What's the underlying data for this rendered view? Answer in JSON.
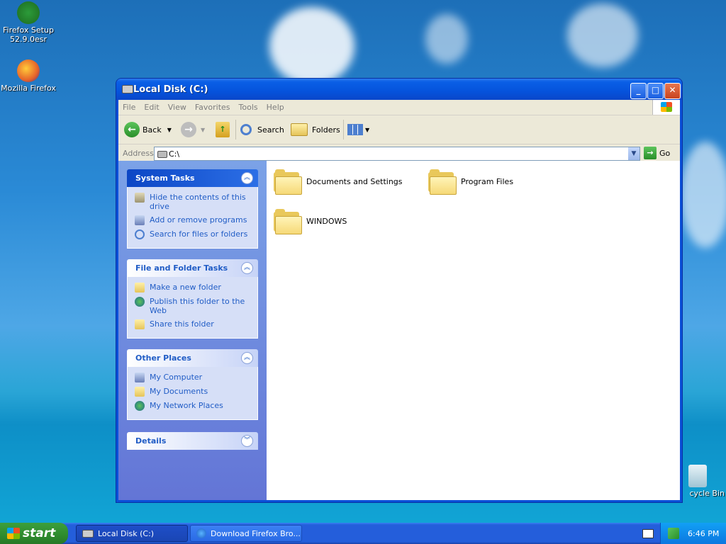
{
  "desktop": {
    "icons": [
      {
        "label": "Firefox Setup 52.9.0esr"
      },
      {
        "label": "Mozilla Firefox"
      },
      {
        "label": "cycle Bin"
      }
    ]
  },
  "window": {
    "title": "Local Disk (C:)",
    "controls": {
      "minimize": "_",
      "maximize": "□",
      "close": "✕"
    },
    "menu": [
      "File",
      "Edit",
      "View",
      "Favorites",
      "Tools",
      "Help"
    ],
    "toolbar": {
      "back": "Back",
      "search": "Search",
      "folders": "Folders"
    },
    "address": {
      "label": "Address",
      "value": "C:\\",
      "go": "Go"
    },
    "panels": [
      {
        "title": "System Tasks",
        "items": [
          "Hide the contents of this drive",
          "Add or remove programs",
          "Search for files or folders"
        ]
      },
      {
        "title": "File and Folder Tasks",
        "items": [
          "Make a new folder",
          "Publish this folder to the Web",
          "Share this folder"
        ]
      },
      {
        "title": "Other Places",
        "items": [
          "My Computer",
          "My Documents",
          "My Network Places"
        ]
      },
      {
        "title": "Details",
        "items": []
      }
    ],
    "folders": [
      "Documents and Settings",
      "Program Files",
      "WINDOWS"
    ]
  },
  "taskbar": {
    "start_label": "start",
    "tasks": [
      "Local Disk (C:)",
      "Download Firefox Bro..."
    ],
    "time": "6:46 PM"
  },
  "colors": {
    "link": "#215dc6",
    "titlebar": "#0553dc",
    "taskbar": "#245edb"
  }
}
